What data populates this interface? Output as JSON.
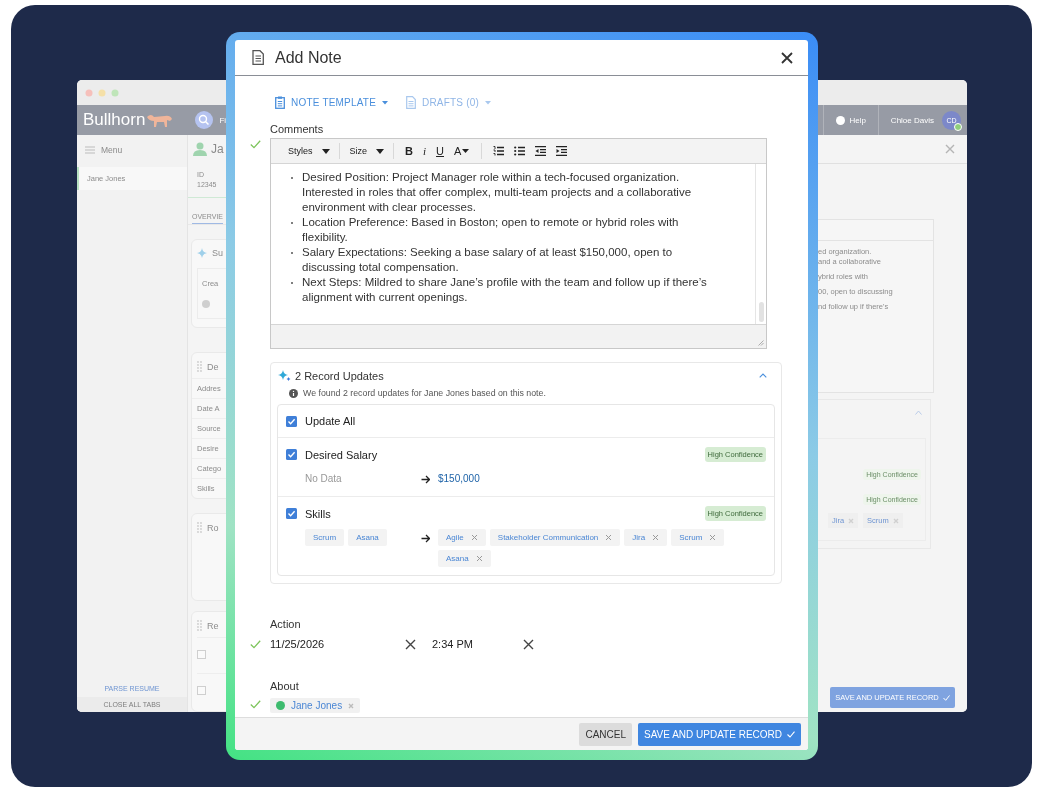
{
  "background_window": {
    "header": {
      "logo": "Bullhorn",
      "search_text": "Fi",
      "help": "Help",
      "user": "Chloe Davis",
      "avatar": "CD",
      "online": true
    },
    "sidebar": {
      "menu": "Menu",
      "items": [
        {
          "label": "Jane Jones",
          "selected": true
        }
      ],
      "parse_resume": "PARSE RESUME",
      "close_all": "CLOSE ALL TABS"
    },
    "record": {
      "name": "Ja",
      "id_label": "ID",
      "id_value": "12345",
      "tabs": [
        {
          "label": "OVERVIE",
          "selected": true
        }
      ],
      "cards": [
        {
          "kind": "summary",
          "title": "Su",
          "text": "Crea"
        },
        {
          "kind": "details",
          "title": "De",
          "rows": [
            "Addres",
            "Date A",
            "Source",
            "Desire",
            "Catego",
            "Skills"
          ]
        },
        {
          "kind": "plain",
          "title": "Ro"
        },
        {
          "kind": "list",
          "title": "Re",
          "rows": [
            {
              "checked": false
            },
            {
              "checked": false
            }
          ]
        }
      ]
    },
    "note_echo": {
      "lines": [
        "ed organization.",
        "and a collaborative",
        "ybrid roles with",
        "00, open to discussing",
        "nd follow up if there's"
      ]
    },
    "updates_echo": {
      "expanded": true,
      "badges": [
        "High Confidence",
        "High Confidence"
      ],
      "chips": [
        "Jira",
        "Scrum"
      ]
    },
    "save_button": "SAVE AND UPDATE RECORD"
  },
  "modal": {
    "title": "Add Note",
    "template_menus": [
      {
        "label": "NOTE TEMPLATE",
        "kind": "template",
        "disabled": false
      },
      {
        "label": "DRAFTS (0)",
        "kind": "drafts",
        "disabled": true
      }
    ],
    "comments": {
      "label": "Comments",
      "valid": true,
      "toolbar": [
        {
          "kind": "dropdown",
          "label": "Styles"
        },
        {
          "kind": "dropdown",
          "label": "Size"
        },
        {
          "kind": "bold",
          "label": "B"
        },
        {
          "kind": "italic",
          "label": "i"
        },
        {
          "kind": "underline",
          "label": "U"
        },
        {
          "kind": "color",
          "label": "A"
        },
        {
          "kind": "numbered-list"
        },
        {
          "kind": "bullet-list"
        },
        {
          "kind": "outdent"
        },
        {
          "kind": "indent"
        }
      ],
      "bullets": [
        "Desired Position: Project Manager role within a tech-focused organization. Interested in roles that offer complex, multi-team projects and a collaborative environment with clear processes.",
        "Location Preference: Based in Boston; open to remote or hybrid roles with flexibility.",
        "Salary Expectations: Seeking a base salary of at least $150,000, open to discussing total compensation.",
        "Next Steps: Mildred to share Jane’s profile with the team and follow up if there’s alignment with current openings."
      ]
    },
    "record_updates": {
      "title": "2 Record Updates",
      "expanded": true,
      "info": "We found 2 record updates for Jane Jones based on this note.",
      "update_all": {
        "label": "Update All",
        "checked": true
      },
      "items": [
        {
          "kind": "value",
          "label": "Desired Salary",
          "checked": true,
          "confidence": "High Confidence",
          "old": "No Data",
          "new": "$150,000"
        },
        {
          "kind": "tags",
          "label": "Skills",
          "checked": true,
          "confidence": "High Confidence",
          "old_tags": [
            "Scrum",
            "Asana"
          ],
          "new_tags": [
            "Agile",
            "Stakeholder Communication",
            "Jira",
            "Scrum",
            "Asana"
          ]
        }
      ]
    },
    "action": {
      "label": "Action",
      "valid": true,
      "date": "11/25/2026",
      "time": "2:34 PM"
    },
    "about": {
      "label": "About",
      "valid": true,
      "chips": [
        {
          "label": "Jane Jones",
          "color": "#3dbb6e"
        }
      ]
    },
    "footer": {
      "cancel": "CANCEL",
      "save": "SAVE AND UPDATE RECORD"
    }
  }
}
